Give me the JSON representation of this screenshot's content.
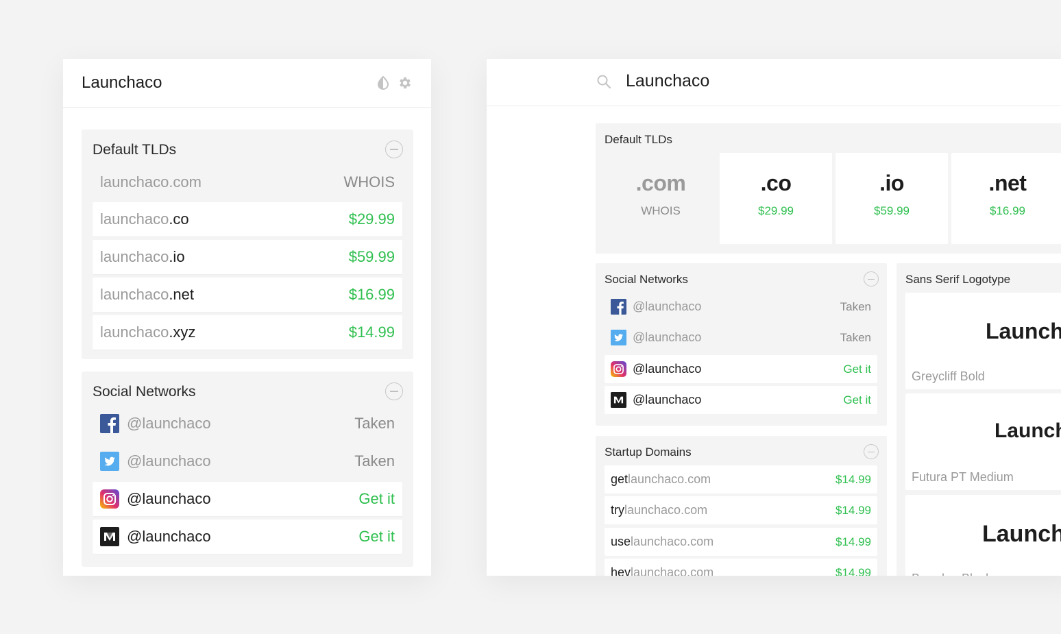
{
  "app": {
    "title": "Launchaco",
    "search_query": "Launchaco"
  },
  "left_panel": {
    "tlds": {
      "title": "Default TLDs",
      "rows": [
        {
          "base": "launchaco",
          "ext": ".com",
          "value": "WHOIS",
          "available": false
        },
        {
          "base": "launchaco",
          "ext": ".co",
          "value": "$29.99",
          "available": true
        },
        {
          "base": "launchaco",
          "ext": ".io",
          "value": "$59.99",
          "available": true
        },
        {
          "base": "launchaco",
          "ext": ".net",
          "value": "$16.99",
          "available": true
        },
        {
          "base": "launchaco",
          "ext": ".xyz",
          "value": "$14.99",
          "available": true
        }
      ]
    },
    "social": {
      "title": "Social Networks",
      "rows": [
        {
          "network": "facebook-icon",
          "handle": "@launchaco",
          "value": "Taken",
          "available": false
        },
        {
          "network": "twitter-icon",
          "handle": "@launchaco",
          "value": "Taken",
          "available": false
        },
        {
          "network": "instagram-icon",
          "handle": "@launchaco",
          "value": "Get it",
          "available": true
        },
        {
          "network": "medium-icon",
          "handle": "@launchaco",
          "value": "Get it",
          "available": true
        }
      ]
    }
  },
  "right_panel": {
    "tlds": {
      "title": "Default TLDs",
      "tiles": [
        {
          "ext": ".com",
          "value": "WHOIS",
          "available": false
        },
        {
          "ext": ".co",
          "value": "$29.99",
          "available": true
        },
        {
          "ext": ".io",
          "value": "$59.99",
          "available": true
        },
        {
          "ext": ".net",
          "value": "$16.99",
          "available": true
        }
      ]
    },
    "social": {
      "title": "Social Networks",
      "rows": [
        {
          "network": "facebook-icon",
          "handle": "@launchaco",
          "value": "Taken",
          "available": false
        },
        {
          "network": "twitter-icon",
          "handle": "@launchaco",
          "value": "Taken",
          "available": false
        },
        {
          "network": "instagram-icon",
          "handle": "@launchaco",
          "value": "Get it",
          "available": true
        },
        {
          "network": "medium-icon",
          "handle": "@launchaco",
          "value": "Get it",
          "available": true
        }
      ]
    },
    "startup": {
      "title": "Startup Domains",
      "rows": [
        {
          "prefix": "get",
          "base": "launchaco.com",
          "value": "$14.99"
        },
        {
          "prefix": "try",
          "base": "launchaco.com",
          "value": "$14.99"
        },
        {
          "prefix": "use",
          "base": "launchaco.com",
          "value": "$14.99"
        },
        {
          "prefix": "hey",
          "base": "launchaco.com",
          "value": "$14.99"
        }
      ]
    },
    "logotype": {
      "title": "Sans Serif Logotype",
      "cards": [
        {
          "word": "Launchaco",
          "font": "Greycliff Bold"
        },
        {
          "word": "Launchaco",
          "font": "Futura PT Medium"
        },
        {
          "word": "Launchaco",
          "font": "Brandon Black"
        }
      ]
    }
  },
  "colors": {
    "accent_green": "#2fbf4f",
    "muted_text": "#9a9a9a",
    "panel_bg": "#ffffff",
    "section_bg": "#f4f4f4",
    "page_bg": "#f3f3f3"
  }
}
